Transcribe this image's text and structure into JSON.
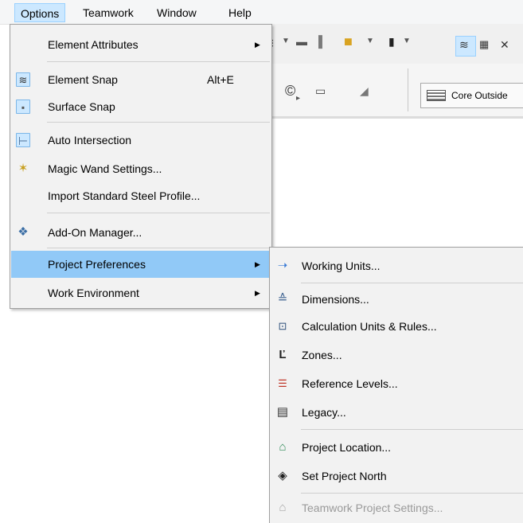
{
  "menubar": {
    "items": [
      "Options",
      "Teamwork",
      "Window",
      "Help"
    ]
  },
  "toolbar": {
    "core_label": "Core Outside"
  },
  "options_menu": {
    "items": [
      {
        "label": "Element Attributes",
        "has_submenu": true
      },
      {
        "label": "Element Snap",
        "shortcut": "Alt+E",
        "icon": "element-snap-icon",
        "checked": true
      },
      {
        "label": "Surface Snap",
        "icon": "surface-snap-icon",
        "checked": true
      },
      {
        "label": "Auto Intersection",
        "icon": "auto-intersection-icon",
        "checked": true
      },
      {
        "label": "Magic Wand Settings...",
        "icon": "magic-wand-icon"
      },
      {
        "label": "Import Standard Steel Profile..."
      },
      {
        "label": "Add-On Manager...",
        "icon": "add-on-manager-icon"
      },
      {
        "label": "Project Preferences",
        "has_submenu": true,
        "highlighted": true
      },
      {
        "label": "Work Environment",
        "has_submenu": true
      }
    ]
  },
  "preferences_submenu": {
    "items": [
      {
        "label": "Working Units...",
        "icon": "working-units-icon"
      },
      {
        "label": "Dimensions...",
        "icon": "dimensions-icon"
      },
      {
        "label": "Calculation Units & Rules...",
        "icon": "calculation-units-icon"
      },
      {
        "label": "Zones...",
        "icon": "zones-icon"
      },
      {
        "label": "Reference Levels...",
        "icon": "reference-levels-icon"
      },
      {
        "label": "Legacy...",
        "icon": "legacy-icon"
      },
      {
        "label": "Project Location...",
        "icon": "project-location-icon"
      },
      {
        "label": "Set Project North",
        "icon": "set-project-north-icon"
      },
      {
        "label": "Teamwork Project Settings...",
        "icon": "teamwork-settings-icon",
        "disabled": true
      }
    ]
  },
  "colors": {
    "highlight": "#91c9f7",
    "menubar_selected": "#cce8ff",
    "menu_bg": "#f2f2f2"
  }
}
